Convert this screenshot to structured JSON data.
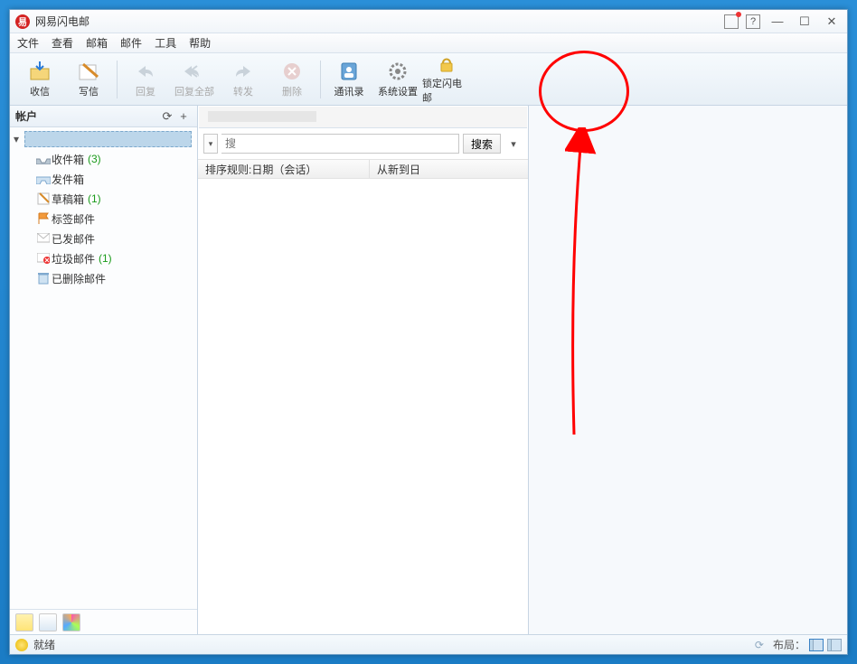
{
  "app": {
    "title": "网易闪电邮"
  },
  "menu": {
    "file": "文件",
    "view": "查看",
    "mailbox": "邮箱",
    "mail": "邮件",
    "tools": "工具",
    "help": "帮助"
  },
  "toolbar": {
    "receive": "收信",
    "compose": "写信",
    "reply": "回复",
    "replyAll": "回复全部",
    "forward": "转发",
    "delete": "删除",
    "contacts": "通讯录",
    "settings": "系统设置",
    "lock": "锁定闪电邮"
  },
  "sidebar": {
    "header": "帐户",
    "folders": [
      {
        "key": "inbox",
        "label": "收件箱",
        "count": "(3)"
      },
      {
        "key": "outbox",
        "label": "发件箱",
        "count": ""
      },
      {
        "key": "drafts",
        "label": "草稿箱",
        "count": "(1)"
      },
      {
        "key": "tagged",
        "label": "标签邮件",
        "count": ""
      },
      {
        "key": "sent",
        "label": "已发邮件",
        "count": ""
      },
      {
        "key": "spam",
        "label": "垃圾邮件",
        "count": "(1)"
      },
      {
        "key": "trash",
        "label": "已删除邮件",
        "count": ""
      }
    ]
  },
  "search": {
    "placeholder": "搜",
    "button": "搜索"
  },
  "sort": {
    "rule": "排序规则:日期（会话）",
    "order": "从新到日"
  },
  "status": {
    "text": "就绪",
    "layoutLabel": "布局："
  }
}
